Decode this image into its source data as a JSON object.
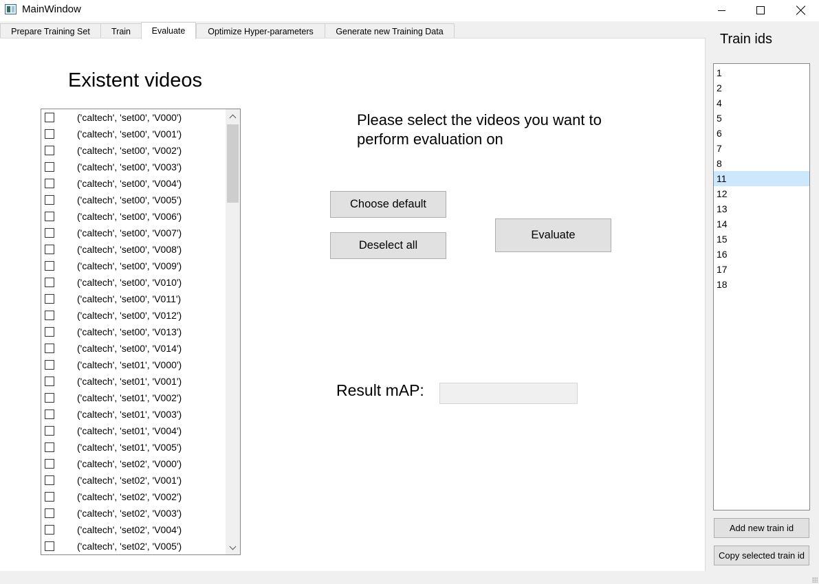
{
  "window": {
    "title": "MainWindow",
    "minimize_icon": "minimize-icon",
    "maximize_icon": "maximize-icon",
    "close_icon": "close-icon"
  },
  "tabs": [
    {
      "label": "Prepare Training Set",
      "active": false
    },
    {
      "label": "Train",
      "active": false
    },
    {
      "label": "Evaluate",
      "active": true
    },
    {
      "label": "Optimize Hyper-parameters",
      "active": false
    },
    {
      "label": "Generate new Training Data",
      "active": false
    }
  ],
  "evaluate": {
    "heading": "Existent videos",
    "videos": [
      {
        "label": "('caltech', 'set00', 'V000')",
        "checked": false
      },
      {
        "label": "('caltech', 'set00', 'V001')",
        "checked": false
      },
      {
        "label": "('caltech', 'set00', 'V002')",
        "checked": false
      },
      {
        "label": "('caltech', 'set00', 'V003')",
        "checked": false
      },
      {
        "label": "('caltech', 'set00', 'V004')",
        "checked": false
      },
      {
        "label": "('caltech', 'set00', 'V005')",
        "checked": false
      },
      {
        "label": "('caltech', 'set00', 'V006')",
        "checked": false
      },
      {
        "label": "('caltech', 'set00', 'V007')",
        "checked": false
      },
      {
        "label": "('caltech', 'set00', 'V008')",
        "checked": false
      },
      {
        "label": "('caltech', 'set00', 'V009')",
        "checked": false
      },
      {
        "label": "('caltech', 'set00', 'V010')",
        "checked": false
      },
      {
        "label": "('caltech', 'set00', 'V011')",
        "checked": false
      },
      {
        "label": "('caltech', 'set00', 'V012')",
        "checked": false
      },
      {
        "label": "('caltech', 'set00', 'V013')",
        "checked": false
      },
      {
        "label": "('caltech', 'set00', 'V014')",
        "checked": false
      },
      {
        "label": "('caltech', 'set01', 'V000')",
        "checked": false
      },
      {
        "label": "('caltech', 'set01', 'V001')",
        "checked": false
      },
      {
        "label": "('caltech', 'set01', 'V002')",
        "checked": false
      },
      {
        "label": "('caltech', 'set01', 'V003')",
        "checked": false
      },
      {
        "label": "('caltech', 'set01', 'V004')",
        "checked": false
      },
      {
        "label": "('caltech', 'set01', 'V005')",
        "checked": false
      },
      {
        "label": "('caltech', 'set02', 'V000')",
        "checked": false
      },
      {
        "label": "('caltech', 'set02', 'V001')",
        "checked": false
      },
      {
        "label": "('caltech', 'set02', 'V002')",
        "checked": false
      },
      {
        "label": "('caltech', 'set02', 'V003')",
        "checked": false
      },
      {
        "label": "('caltech', 'set02', 'V004')",
        "checked": false
      },
      {
        "label": "('caltech', 'set02', 'V005')",
        "checked": false
      }
    ],
    "prompt": "Please select the videos you want to perform evaluation on",
    "choose_default_label": "Choose default",
    "deselect_all_label": "Deselect all",
    "evaluate_label": "Evaluate",
    "result_label": "Result mAP:",
    "result_value": ""
  },
  "train_ids": {
    "title": "Train ids",
    "items": [
      "1",
      "2",
      "4",
      "5",
      "6",
      "7",
      "8",
      "11",
      "12",
      "13",
      "14",
      "15",
      "16",
      "17",
      "18"
    ],
    "selected": "11",
    "add_label": "Add new train id",
    "copy_label": "Copy selected train id"
  },
  "colors": {
    "selection": "#cce8ff",
    "button_face": "#e1e1e1",
    "button_border": "#adadad"
  }
}
